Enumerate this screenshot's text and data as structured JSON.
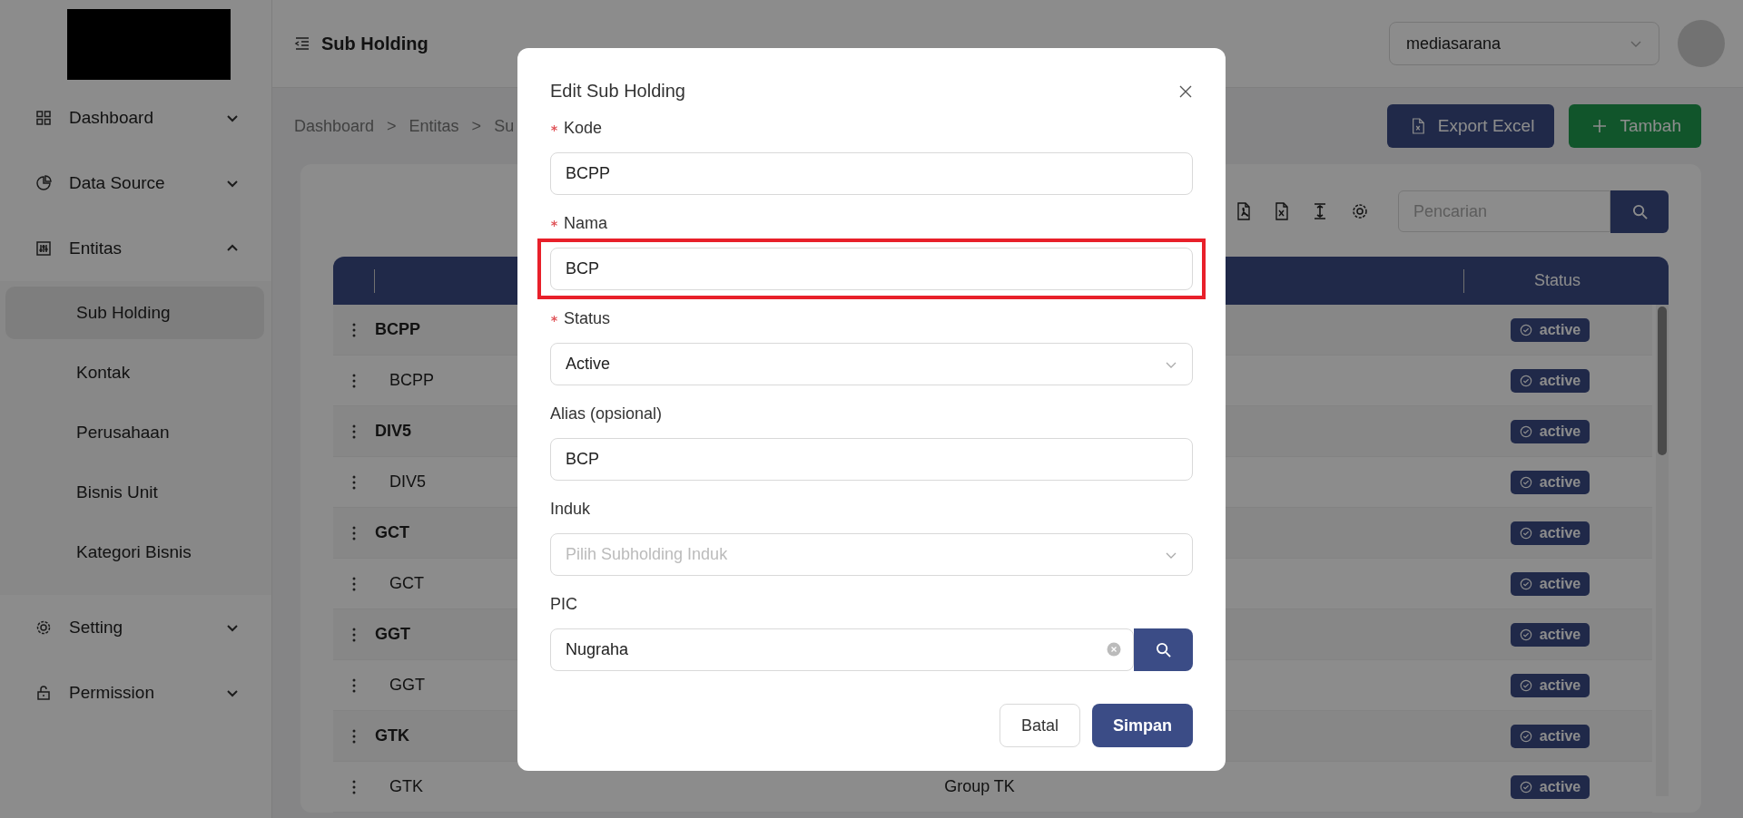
{
  "sidebar": {
    "items": [
      {
        "label": "Dashboard",
        "expanded": false
      },
      {
        "label": "Data Source",
        "expanded": false
      },
      {
        "label": "Entitas",
        "expanded": true,
        "children": [
          {
            "label": "Sub Holding",
            "selected": true
          },
          {
            "label": "Kontak",
            "selected": false
          },
          {
            "label": "Perusahaan",
            "selected": false
          },
          {
            "label": "Bisnis Unit",
            "selected": false
          },
          {
            "label": "Kategori Bisnis",
            "selected": false
          }
        ]
      },
      {
        "label": "Setting",
        "expanded": false
      },
      {
        "label": "Permission",
        "expanded": false
      }
    ]
  },
  "header": {
    "title": "Sub Holding",
    "company_select": "mediasarana"
  },
  "breadcrumb": {
    "items": [
      "Dashboard",
      "Entitas",
      "Su"
    ],
    "separators": [
      ">",
      ">"
    ]
  },
  "actions": [
    {
      "label": "Export Excel",
      "kind": "export"
    },
    {
      "label": "Tambah",
      "kind": "add"
    }
  ],
  "table": {
    "search": {
      "placeholder": "Pencarian"
    },
    "status_header": "Status",
    "rows": [
      {
        "kode": "BCPP",
        "status": "active",
        "children": [
          {
            "kode": "BCPP",
            "status": "active"
          }
        ]
      },
      {
        "kode": "DIV5",
        "status": "active",
        "children": [
          {
            "kode": "DIV5",
            "status": "active"
          }
        ]
      },
      {
        "kode": "GCT",
        "status": "active",
        "children": [
          {
            "kode": "GCT",
            "status": "active"
          }
        ]
      },
      {
        "kode": "GGT",
        "status": "active",
        "children": [
          {
            "kode": "GGT",
            "status": "active"
          }
        ]
      },
      {
        "kode": "GTK",
        "status": "active",
        "children": [
          {
            "kode": "GTK",
            "column_3": "Group TK",
            "status": "active"
          }
        ]
      }
    ]
  },
  "modal": {
    "title": "Edit Sub Holding",
    "fields": [
      {
        "label": "Kode",
        "required": true,
        "kind": "input",
        "value": "BCPP",
        "highlighted": false
      },
      {
        "label": "Nama",
        "required": true,
        "kind": "input",
        "value": "BCP",
        "highlighted": true
      },
      {
        "label": "Status",
        "required": true,
        "kind": "select",
        "value": "Active",
        "highlighted": false
      },
      {
        "label": "Alias (opsional)",
        "required": false,
        "kind": "input",
        "value": "BCP",
        "highlighted": false
      },
      {
        "label": "Induk",
        "required": false,
        "kind": "select",
        "placeholder": "Pilih Subholding Induk",
        "highlighted": false
      },
      {
        "label": "PIC",
        "required": false,
        "kind": "search",
        "value": "Nugraha",
        "highlighted": false
      }
    ],
    "buttons": [
      {
        "label": "Batal",
        "kind": "secondary"
      },
      {
        "label": "Simpan",
        "kind": "primary"
      }
    ]
  }
}
